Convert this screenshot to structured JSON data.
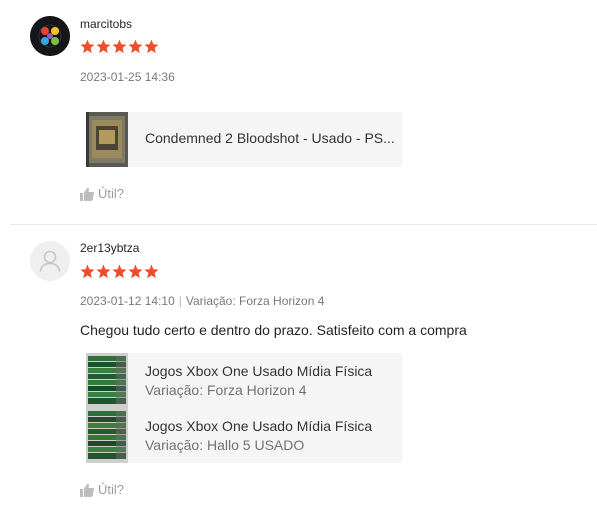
{
  "reviews": [
    {
      "username": "marcitobs",
      "rating": 5,
      "date": "2023-01-25 14:36",
      "variation_text": "",
      "comment": "",
      "products": [
        {
          "name": "Condemned 2 Bloodshot - Usado - PS...",
          "variation": ""
        }
      ],
      "helpful_label": "Útil?"
    },
    {
      "username": "2er13ybtza",
      "rating": 5,
      "date": "2023-01-12 14:10",
      "variation_text": "Variação: Forza Horizon 4",
      "comment": "Chegou tudo certo e dentro do prazo. Satisfeito com a compra",
      "products": [
        {
          "name": "Jogos Xbox One Usado Mídia Física",
          "variation": "Variação: Forza Horizon 4"
        },
        {
          "name": "Jogos Xbox One Usado Mídia Física",
          "variation": "Variação: Hallo 5 USADO"
        }
      ],
      "helpful_label": "Útil?"
    }
  ],
  "colors": {
    "star": "#ee4d2d",
    "product_bg": "#f5f5f5",
    "divider": "#e8e8e8"
  },
  "icons": {
    "star": "star-icon",
    "helpful": "thumbs-up-icon",
    "avatar_default": "user-silhouette-icon"
  }
}
